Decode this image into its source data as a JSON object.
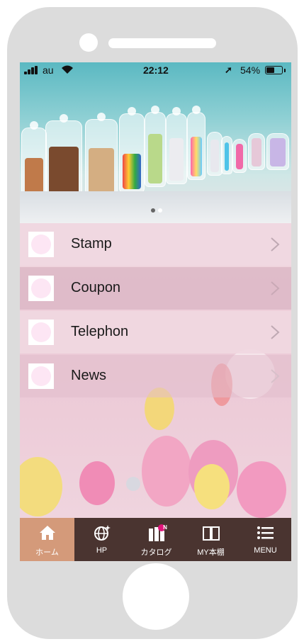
{
  "status_bar": {
    "carrier": "au",
    "time": "22:12",
    "battery": "54%",
    "battery_level": 0.54,
    "signal_bars": 4
  },
  "hero": {
    "slide_count": 2,
    "active_slide": 1
  },
  "menu": {
    "items": [
      {
        "label": "Stamp",
        "icon": "stamp-thumb"
      },
      {
        "label": "Coupon",
        "icon": "coupon-thumb"
      },
      {
        "label": "Telephon",
        "icon": "telephone-thumb"
      },
      {
        "label": "News",
        "icon": "news-thumb"
      }
    ]
  },
  "tabbar": {
    "tabs": [
      {
        "label": "ホーム",
        "icon": "home-icon",
        "active": true
      },
      {
        "label": "HP",
        "icon": "globe-icon",
        "active": false
      },
      {
        "label": "カタログ",
        "icon": "catalog-icon",
        "badge": "N",
        "active": false
      },
      {
        "label": "MY本棚",
        "icon": "book-icon",
        "active": false
      },
      {
        "label": "MENU",
        "icon": "list-icon",
        "active": false
      }
    ]
  },
  "colors": {
    "tabbar_bg": "#4a3430",
    "tab_active": "#d49a7a",
    "catalog_badge": "#e0157a",
    "menu_row_light": "#f0d8e1",
    "menu_row_dark": "#dcb7c6"
  }
}
